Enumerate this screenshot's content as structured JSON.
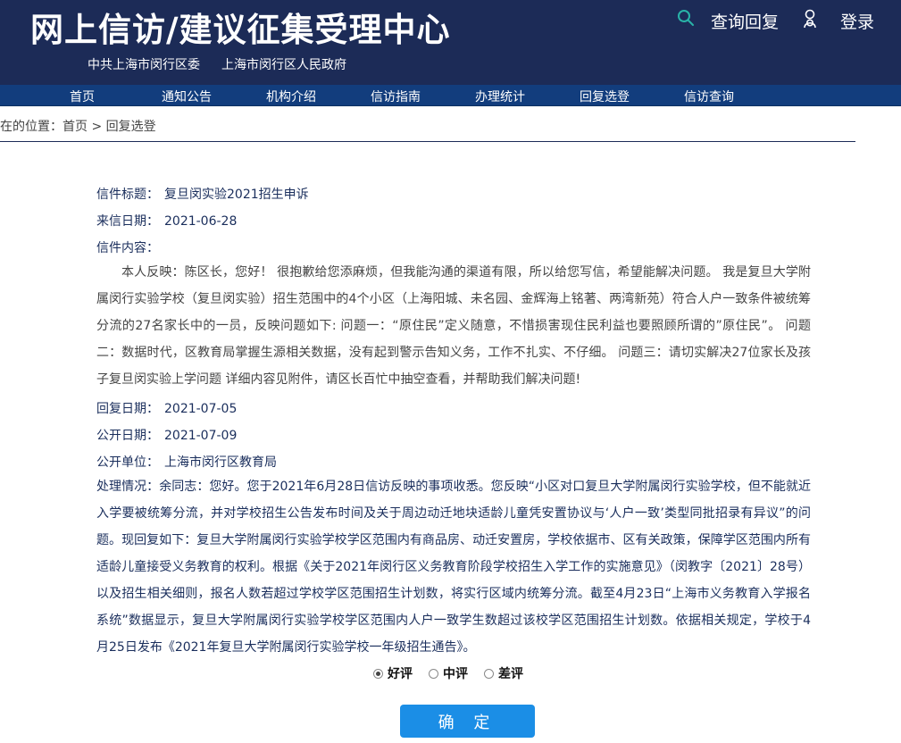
{
  "header": {
    "title": "网上信访/建议征集受理中心",
    "org_left": "中共上海市闵行区委",
    "org_right": "上海市闵行区人民政府",
    "query_label": "查询回复",
    "login_label": "登录",
    "icons": {
      "search": "search-icon",
      "user": "user-icon"
    },
    "accent_color": "#1c2b57"
  },
  "nav": {
    "items": [
      "首页",
      "通知公告",
      "机构介绍",
      "信访指南",
      "办理统计",
      "回复选登",
      "信访查询"
    ],
    "color": "#123d7d"
  },
  "breadcrumb": "所在的位置：首页 > 回复选登",
  "letter": {
    "title_label": "信件标题：",
    "title_value": "复旦闵实验2021招生申诉",
    "date_label": "来信日期：",
    "date_value": "2021-06-28",
    "content_label": "信件内容：",
    "content_text": "本人反映：陈区长，您好！ 很抱歉给您添麻烦，但我能沟通的渠道有限，所以给您写信，希望能解决问题。 我是复旦大学附属闵行实验学校（复旦闵实验）招生范围中的4个小区（上海阳城、未名园、金辉海上铭著、两湾新苑）符合人户一致条件被统筹分流的27名家长中的一员，反映问题如下: 问题一：“原住民”定义随意，不惜损害现住民利益也要照顾所谓的”原住民”。 问题二：数据时代，区教育局掌握生源相关数据，没有起到警示告知义务，工作不扎实、不仔细。 问题三：请切实解决27位家长及孩子复旦闵实验上学问题 详细内容见附件，请区长百忙中抽空查看，并帮助我们解决问题!",
    "reply_date_label": "回复日期：",
    "reply_date_value": "2021-07-05",
    "public_date_label": "公开日期：",
    "public_date_value": "2021-07-09",
    "public_unit_label": "公开单位：",
    "public_unit_value": "上海市闵行区教育局",
    "handling_label": "处理情况：",
    "handling_text": "余同志：您好。您于2021年6月28日信访反映的事项收悉。您反映“小区对口复旦大学附属闵行实验学校，但不能就近入学要被统筹分流，并对学校招生公告发布时间及关于周边动迁地块适龄儿童凭安置协议与‘人户一致’类型同批招录有异议”的问题。现回复如下：复旦大学附属闵行实验学校学区范围内有商品房、动迁安置房，学校依据市、区有关政策，保障学区范围内所有适龄儿童接受义务教育的权利。根据《关于2021年闵行区义务教育阶段学校招生入学工作的实施意见》（闵教字〔2021〕28号）以及招生相关细则，报名人数若超过学校学区范围招生计划数，将实行区域内统筹分流。截至4月23日“上海市义务教育入学报名系统”数据显示，复旦大学附属闵行实验学校学区范围内人户一致学生数超过该校学区范围招生计划数。依据相关规定，学校于4月25日发布《2021年复旦大学附属闵行实验学校一年级招生通告》。"
  },
  "rating": {
    "options": [
      "好评",
      "中评",
      "差评"
    ],
    "selected": "好评"
  },
  "confirm_label": "确 定",
  "confirm_color": "#1b8ee6"
}
